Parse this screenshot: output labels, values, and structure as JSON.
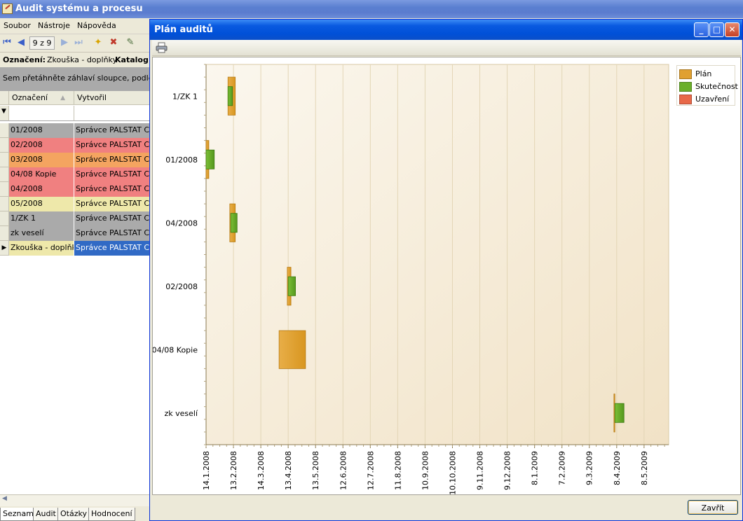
{
  "app": {
    "title": "Audit systému a procesu",
    "menu": [
      "Soubor",
      "Nástroje",
      "Nápověda"
    ],
    "pager": "9 z 9",
    "filter_label_1": "Označení:",
    "filter_value_1": "Zkouška - doplňky",
    "filter_label_2": "Katalog:",
    "group_hint": "Sem přetáhněte záhlaví sloupce, podle kterého chcete seskupit",
    "grid": {
      "columns": [
        "Označení",
        "Vytvořil"
      ],
      "rows": [
        {
          "id": "01/2008",
          "by": "Správce PALSTAT CAQ",
          "color": "#aaaaaa"
        },
        {
          "id": "02/2008",
          "by": "Správce PALSTAT CAQ",
          "color": "#f08080"
        },
        {
          "id": "03/2008",
          "by": "Správce PALSTAT CAQ",
          "color": "#f4a460"
        },
        {
          "id": "04/08 Kopie",
          "by": "Správce PALSTAT CAQ",
          "color": "#f08080"
        },
        {
          "id": "04/2008",
          "by": "Správce PALSTAT CAQ",
          "color": "#f08080"
        },
        {
          "id": "05/2008",
          "by": "Správce PALSTAT CAQ",
          "color": "#eee8aa"
        },
        {
          "id": "1/ZK 1",
          "by": "Správce PALSTAT CAQ",
          "color": "#aaaaaa"
        },
        {
          "id": "zk veselí",
          "by": "Správce PALSTAT CAQ",
          "color": "#aaaaaa"
        },
        {
          "id": "Zkouška - doplňky",
          "by": "Správce PALSTAT CAQ",
          "color": "#eee8aa",
          "selected": true
        }
      ]
    },
    "tabs": [
      "Seznam",
      "Audit",
      "Otázky",
      "Hodnocení"
    ]
  },
  "dialog": {
    "title": "Plán auditů",
    "close_label": "Zavřít",
    "toolbar_icon": "print-icon"
  },
  "chart_data": {
    "type": "bar",
    "orientation": "horizontal-gantt",
    "categories": [
      "1/ZK 1",
      "01/2008",
      "04/2008",
      "02/2008",
      "04/08 Kopie",
      "zk veselí"
    ],
    "x_ticks": [
      "14.1.2008",
      "13.2.2008",
      "14.3.2008",
      "13.4.2008",
      "13.5.2008",
      "12.6.2008",
      "12.7.2008",
      "11.8.2008",
      "10.9.2008",
      "10.10.2008",
      "9.11.2008",
      "9.12.2008",
      "8.1.2009",
      "7.2.2009",
      "9.3.2009",
      "8.4.2009",
      "8.5.2009"
    ],
    "xlim": [
      "2008-01-14",
      "2009-06-04"
    ],
    "series": [
      {
        "name": "Plán",
        "color": "#e0a030",
        "values": [
          [
            "2008-02-07",
            "2008-02-15"
          ],
          [
            "2008-01-14",
            "2008-01-17"
          ],
          [
            "2008-02-09",
            "2008-02-15"
          ],
          [
            "2008-04-12",
            "2008-04-16"
          ],
          [
            "2008-04-03",
            "2008-05-02"
          ],
          [
            "2009-04-05",
            "2009-04-06"
          ]
        ]
      },
      {
        "name": "Skutečnost",
        "color": "#6aaf2a",
        "values": [
          [
            "2008-02-07",
            "2008-02-12"
          ],
          [
            "2008-01-14",
            "2008-01-23"
          ],
          [
            "2008-02-10",
            "2008-02-17"
          ],
          [
            "2008-04-13",
            "2008-04-21"
          ],
          null,
          [
            "2009-04-06",
            "2009-04-16"
          ]
        ]
      },
      {
        "name": "Uzavření",
        "color": "#e86848",
        "values": [
          null,
          null,
          null,
          null,
          null,
          null
        ]
      }
    ],
    "grid": true,
    "legend": "top-right"
  }
}
